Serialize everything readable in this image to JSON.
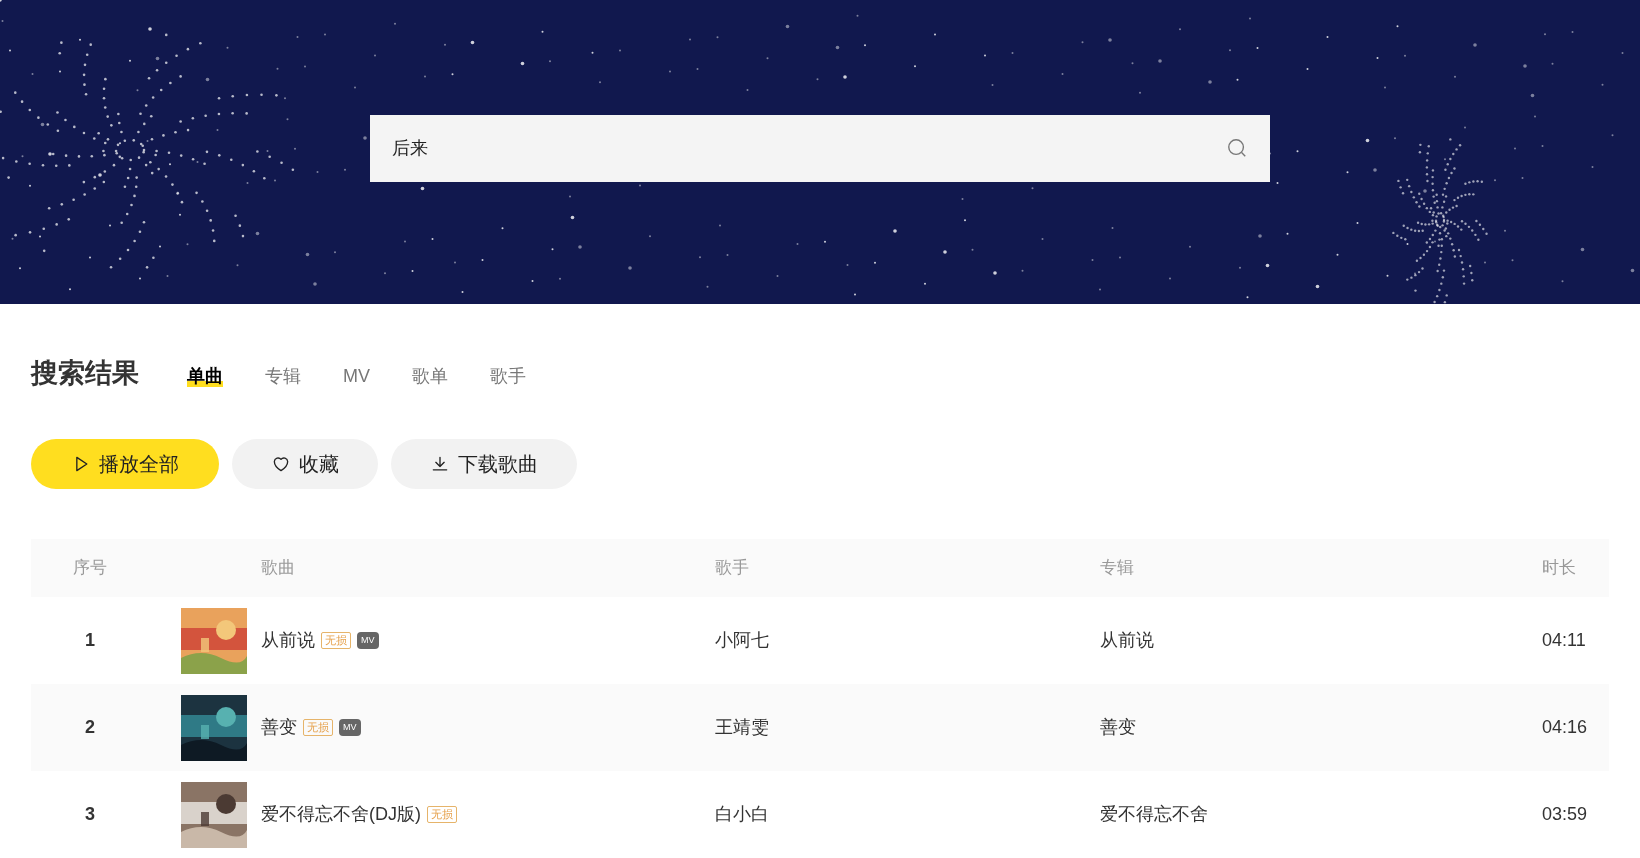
{
  "search": {
    "value": "后来"
  },
  "results": {
    "title": "搜索结果",
    "tabs": [
      {
        "label": "单曲",
        "selected": true
      },
      {
        "label": "专辑",
        "selected": false
      },
      {
        "label": "MV",
        "selected": false
      },
      {
        "label": "歌单",
        "selected": false
      },
      {
        "label": "歌手",
        "selected": false
      }
    ],
    "actions": [
      {
        "kind": "play",
        "label": "播放全部"
      },
      {
        "kind": "favorite",
        "label": "收藏"
      },
      {
        "kind": "download",
        "label": "下载歌曲"
      }
    ],
    "table": {
      "columns": [
        "序号",
        "歌曲",
        "歌手",
        "专辑",
        "时长"
      ],
      "rows": [
        {
          "index": "1",
          "song": "从前说",
          "badges": [
            {
              "kind": "lossless",
              "label": "无损"
            },
            {
              "kind": "mv",
              "label": "MV"
            }
          ],
          "singer": "小阿七",
          "album": "从前说",
          "duration": "04:11"
        },
        {
          "index": "2",
          "song": "善变",
          "badges": [
            {
              "kind": "lossless",
              "label": "无损"
            },
            {
              "kind": "mv",
              "label": "MV"
            }
          ],
          "singer": "王靖雯",
          "album": "善变",
          "duration": "04:16"
        },
        {
          "index": "3",
          "song": "爱不得忘不舍(DJ版)",
          "badges": [
            {
              "kind": "lossless",
              "label": "无损"
            }
          ],
          "singer": "白小白",
          "album": "爱不得忘不舍",
          "duration": "03:59"
        }
      ]
    }
  }
}
